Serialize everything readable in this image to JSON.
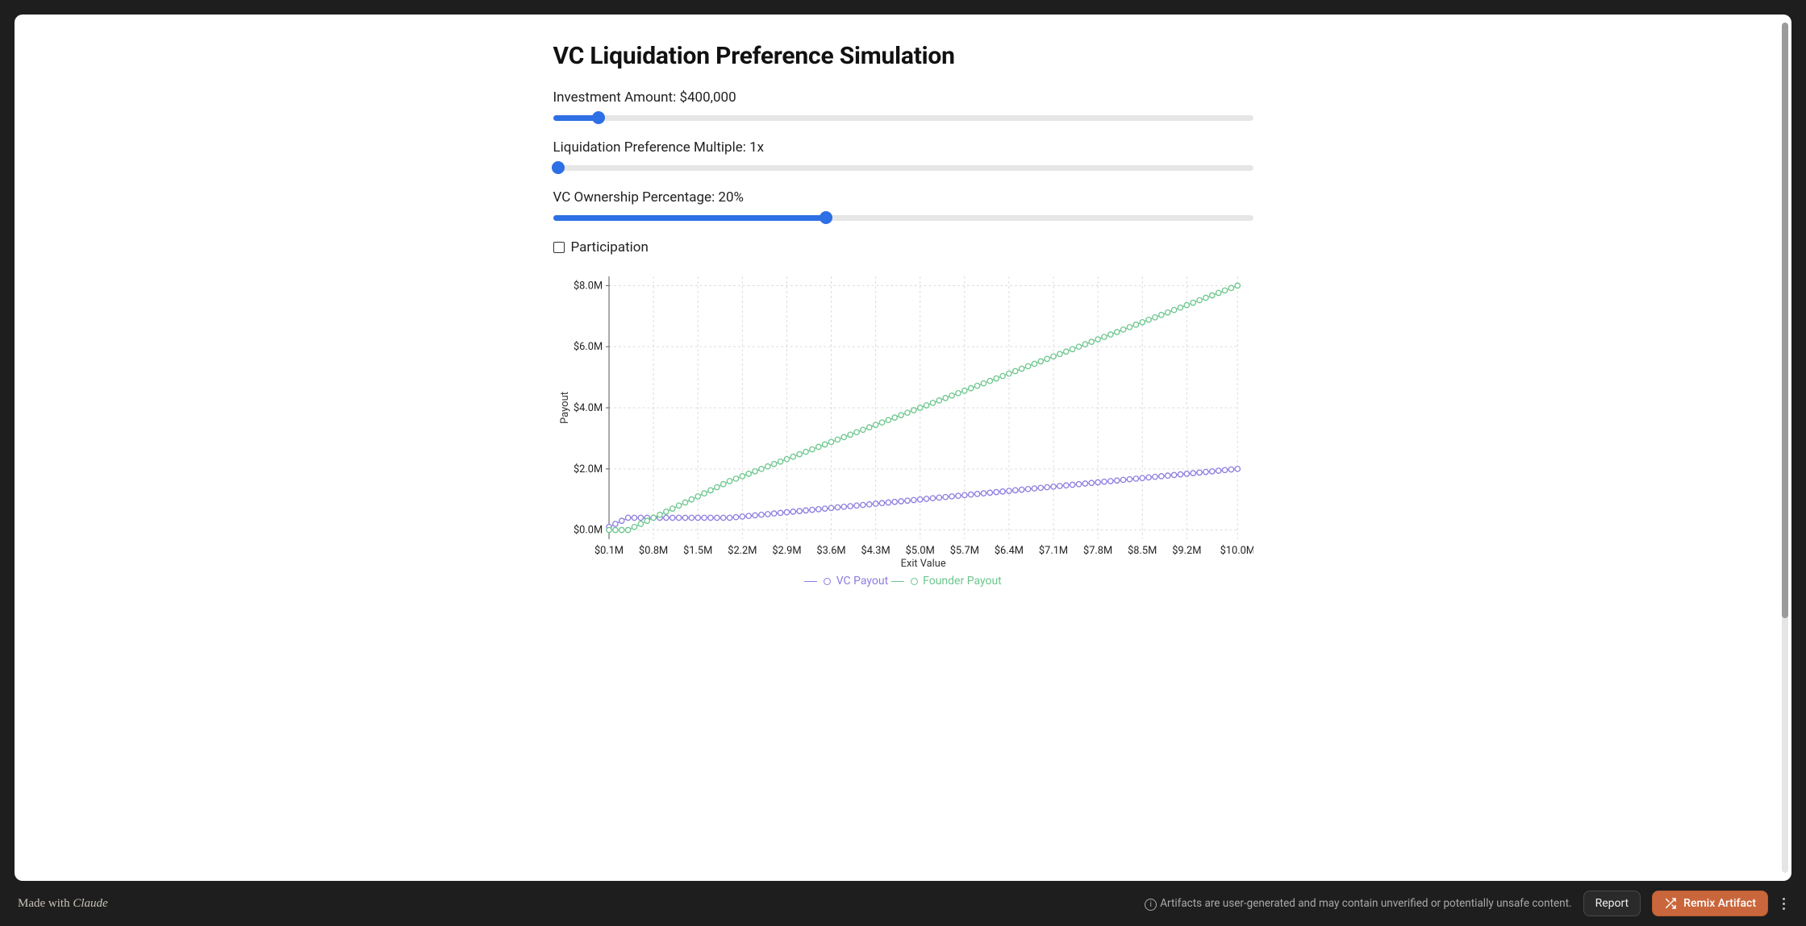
{
  "page": {
    "title": "VC Liquidation Preference Simulation"
  },
  "controls": {
    "investment": {
      "label_prefix": "Investment Amount: ",
      "value_display": "$400,000",
      "fill_pct": 6.5
    },
    "multiple": {
      "label_prefix": "Liquidation Preference Multiple: ",
      "value_display": "1x",
      "fill_pct": 0
    },
    "ownership": {
      "label_prefix": "VC Ownership Percentage: ",
      "value_display": "20%",
      "fill_pct": 39
    },
    "participation": {
      "label": "Participation",
      "checked": false
    }
  },
  "chart_data": {
    "type": "line",
    "title": "",
    "xlabel": "Exit Value",
    "ylabel": "Payout",
    "xlim": [
      0.1,
      10.0
    ],
    "ylim": [
      0.0,
      8.0
    ],
    "x_ticks": [
      "$0.1M",
      "$0.8M",
      "$1.5M",
      "$2.2M",
      "$2.9M",
      "$3.6M",
      "$4.3M",
      "$5.0M",
      "$5.7M",
      "$6.4M",
      "$7.1M",
      "$7.8M",
      "$8.5M",
      "$9.2M",
      "$10.0M"
    ],
    "y_ticks": [
      "$0.0M",
      "$2.0M",
      "$4.0M",
      "$6.0M",
      "$8.0M"
    ],
    "series": [
      {
        "name": "VC Payout",
        "color": "#8b7de0",
        "x": [
          0.1,
          0.2,
          0.3,
          0.4,
          0.5,
          0.6,
          0.7,
          0.8,
          0.9,
          1.0,
          1.1,
          1.2,
          1.3,
          1.4,
          1.5,
          1.6,
          1.7,
          1.8,
          1.9,
          2.0,
          2.1,
          2.2,
          2.3,
          2.4,
          2.5,
          2.6,
          2.7,
          2.8,
          2.9,
          3.0,
          3.1,
          3.2,
          3.3,
          3.4,
          3.5,
          3.6,
          3.7,
          3.8,
          3.9,
          4.0,
          4.1,
          4.2,
          4.3,
          4.4,
          4.5,
          4.6,
          4.7,
          4.8,
          4.9,
          5.0,
          5.1,
          5.2,
          5.3,
          5.4,
          5.5,
          5.6,
          5.7,
          5.8,
          5.9,
          6.0,
          6.1,
          6.2,
          6.3,
          6.4,
          6.5,
          6.6,
          6.7,
          6.8,
          6.9,
          7.0,
          7.1,
          7.2,
          7.3,
          7.4,
          7.5,
          7.6,
          7.7,
          7.8,
          7.9,
          8.0,
          8.1,
          8.2,
          8.3,
          8.4,
          8.5,
          8.6,
          8.7,
          8.8,
          8.9,
          9.0,
          9.1,
          9.2,
          9.3,
          9.4,
          9.5,
          9.6,
          9.7,
          9.8,
          9.9,
          10.0
        ],
        "values": [
          0.1,
          0.2,
          0.3,
          0.4,
          0.4,
          0.4,
          0.4,
          0.4,
          0.4,
          0.4,
          0.4,
          0.4,
          0.4,
          0.4,
          0.4,
          0.4,
          0.4,
          0.4,
          0.4,
          0.4,
          0.42,
          0.44,
          0.46,
          0.48,
          0.5,
          0.52,
          0.54,
          0.56,
          0.58,
          0.6,
          0.62,
          0.64,
          0.66,
          0.68,
          0.7,
          0.72,
          0.74,
          0.76,
          0.78,
          0.8,
          0.82,
          0.84,
          0.86,
          0.88,
          0.9,
          0.92,
          0.94,
          0.96,
          0.98,
          1.0,
          1.02,
          1.04,
          1.06,
          1.08,
          1.1,
          1.12,
          1.14,
          1.16,
          1.18,
          1.2,
          1.22,
          1.24,
          1.26,
          1.28,
          1.3,
          1.32,
          1.34,
          1.36,
          1.38,
          1.4,
          1.42,
          1.44,
          1.46,
          1.48,
          1.5,
          1.52,
          1.54,
          1.56,
          1.58,
          1.6,
          1.62,
          1.64,
          1.66,
          1.68,
          1.7,
          1.72,
          1.74,
          1.76,
          1.78,
          1.8,
          1.82,
          1.84,
          1.86,
          1.88,
          1.9,
          1.92,
          1.94,
          1.96,
          1.98,
          2.0
        ]
      },
      {
        "name": "Founder Payout",
        "color": "#6cc68d",
        "x": [
          0.1,
          0.2,
          0.3,
          0.4,
          0.5,
          0.6,
          0.7,
          0.8,
          0.9,
          1.0,
          1.1,
          1.2,
          1.3,
          1.4,
          1.5,
          1.6,
          1.7,
          1.8,
          1.9,
          2.0,
          2.1,
          2.2,
          2.3,
          2.4,
          2.5,
          2.6,
          2.7,
          2.8,
          2.9,
          3.0,
          3.1,
          3.2,
          3.3,
          3.4,
          3.5,
          3.6,
          3.7,
          3.8,
          3.9,
          4.0,
          4.1,
          4.2,
          4.3,
          4.4,
          4.5,
          4.6,
          4.7,
          4.8,
          4.9,
          5.0,
          5.1,
          5.2,
          5.3,
          5.4,
          5.5,
          5.6,
          5.7,
          5.8,
          5.9,
          6.0,
          6.1,
          6.2,
          6.3,
          6.4,
          6.5,
          6.6,
          6.7,
          6.8,
          6.9,
          7.0,
          7.1,
          7.2,
          7.3,
          7.4,
          7.5,
          7.6,
          7.7,
          7.8,
          7.9,
          8.0,
          8.1,
          8.2,
          8.3,
          8.4,
          8.5,
          8.6,
          8.7,
          8.8,
          8.9,
          9.0,
          9.1,
          9.2,
          9.3,
          9.4,
          9.5,
          9.6,
          9.7,
          9.8,
          9.9,
          10.0
        ],
        "values": [
          0.0,
          0.0,
          0.0,
          0.0,
          0.1,
          0.2,
          0.3,
          0.4,
          0.5,
          0.6,
          0.7,
          0.8,
          0.9,
          1.0,
          1.1,
          1.2,
          1.3,
          1.4,
          1.5,
          1.6,
          1.68,
          1.76,
          1.84,
          1.92,
          2.0,
          2.08,
          2.16,
          2.24,
          2.32,
          2.4,
          2.48,
          2.56,
          2.64,
          2.72,
          2.8,
          2.88,
          2.96,
          3.04,
          3.12,
          3.2,
          3.28,
          3.36,
          3.44,
          3.52,
          3.6,
          3.68,
          3.76,
          3.84,
          3.92,
          4.0,
          4.08,
          4.16,
          4.24,
          4.32,
          4.4,
          4.48,
          4.56,
          4.64,
          4.72,
          4.8,
          4.88,
          4.96,
          5.04,
          5.12,
          5.2,
          5.28,
          5.36,
          5.44,
          5.52,
          5.6,
          5.68,
          5.76,
          5.84,
          5.92,
          6.0,
          6.08,
          6.16,
          6.24,
          6.32,
          6.4,
          6.48,
          6.56,
          6.64,
          6.72,
          6.8,
          6.88,
          6.96,
          7.04,
          7.12,
          7.2,
          7.28,
          7.36,
          7.44,
          7.52,
          7.6,
          7.68,
          7.76,
          7.84,
          7.92,
          8.0
        ]
      }
    ]
  },
  "footer": {
    "made_prefix": "Made with ",
    "brand": "Claude",
    "warning": "Artifacts are user-generated and may contain unverified or potentially unsafe content.",
    "report_label": "Report",
    "remix_label": "Remix Artifact"
  }
}
